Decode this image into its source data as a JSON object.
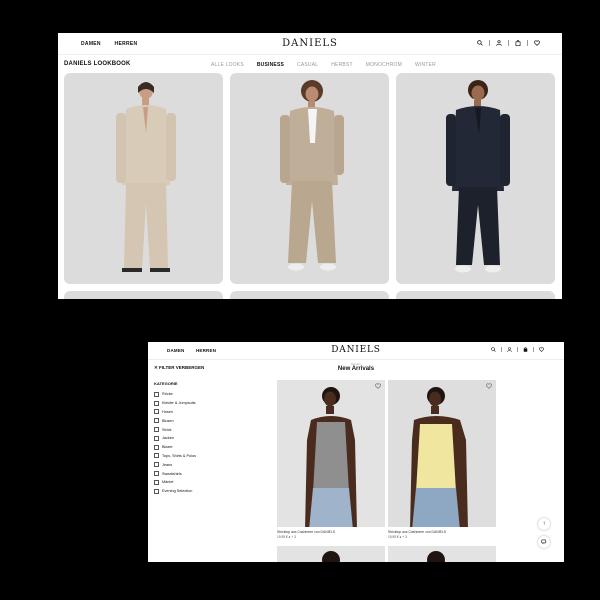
{
  "screen1": {
    "nav": [
      "DAMEN",
      "HERREN"
    ],
    "logo": "DANIELS",
    "icons": [
      "search-icon",
      "account-icon",
      "bag-icon",
      "heart-icon"
    ],
    "section_title": "DANIELS LOOKBOOK",
    "tabs": [
      {
        "label": "ALLE LOOKS",
        "active": false
      },
      {
        "label": "BUSINESS",
        "active": true
      },
      {
        "label": "CASUAL",
        "active": false
      },
      {
        "label": "HERBST",
        "active": false
      },
      {
        "label": "MONOCHROM",
        "active": false
      },
      {
        "label": "WINTER",
        "active": false
      }
    ]
  },
  "screen2": {
    "nav": [
      "DAMEN",
      "HERREN"
    ],
    "logo": "DANIELS",
    "filter_toggle": "FILTER VERBERGEN",
    "breadcrumb": "Damen",
    "title": "New Arrivals",
    "category_title": "KATEGORIE",
    "categories": [
      "Röcke",
      "Kleider & Jumpsuits",
      "Hosen",
      "Blusen",
      "Strick",
      "Jacken",
      "Blazer",
      "Tops, Shirts & Polos",
      "Jeans",
      "Sweatshirts",
      "Mäntel",
      "Evening Selection"
    ],
    "products": [
      {
        "name": "Stricktop aus Cashmere von DANIELS",
        "price": "19,95 €   ● + 3"
      },
      {
        "name": "Stricktop aus Cashmere von DANIELS",
        "price": "19,95 €   ● + 3"
      }
    ]
  },
  "colors": {
    "card_bg": "#dcdcdc",
    "navy_suit": "#222835",
    "beige_suit": "#d8cbb8",
    "taupe_suit": "#bfae98",
    "yellow_top": "#f1e6a0",
    "grey_top": "#8f8f8f",
    "denim": "#9fb4cb"
  }
}
